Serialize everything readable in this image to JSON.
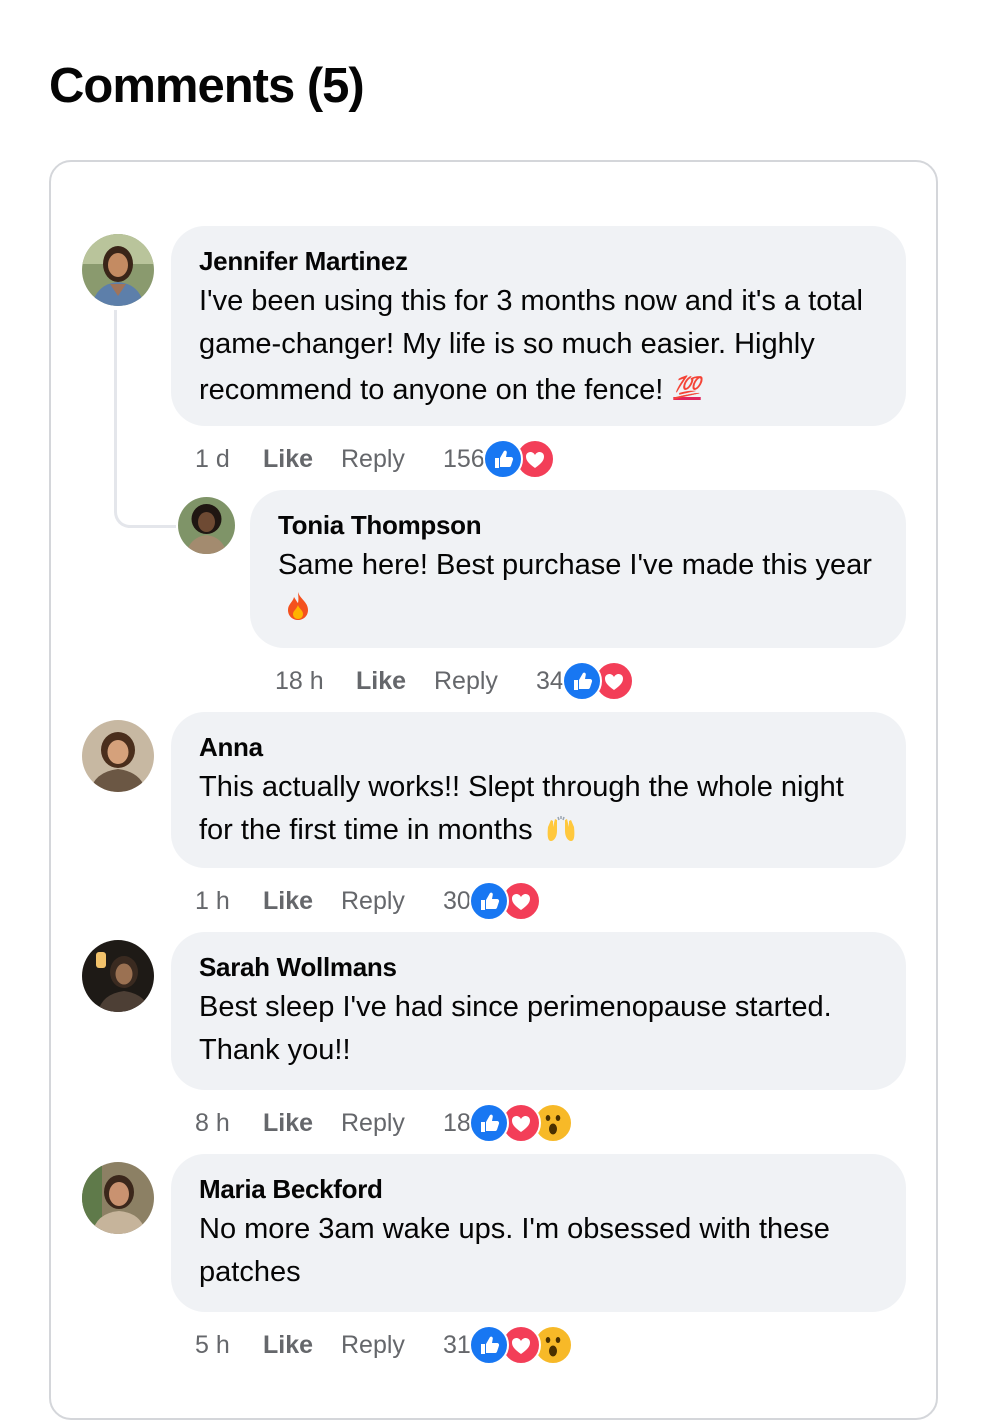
{
  "heading": "Comments (5)",
  "comments": [
    {
      "name": "Jennifer Martinez",
      "text": "I've been using this for 3 months now and it's a total game-changer! My life is so much easier. Highly recommend to anyone on the fence!",
      "emoji": "💯",
      "time": "1 d",
      "like": "Like",
      "reply": "Reply",
      "count": "156",
      "reactions": [
        "like",
        "love"
      ]
    },
    {
      "name": "Tonia Thompson",
      "text": "Same here! Best purchase I've made this year",
      "emoji": "🔥",
      "time": "18 h",
      "like": "Like",
      "reply": "Reply",
      "count": "34",
      "reactions": [
        "like",
        "love"
      ]
    },
    {
      "name": "Anna",
      "text": "This actually works!! Slept through the whole night for the first time in months",
      "emoji": "🙌",
      "time": "1 h",
      "like": "Like",
      "reply": "Reply",
      "count": "30",
      "reactions": [
        "like",
        "love"
      ]
    },
    {
      "name": "Sarah Wollmans",
      "text": "Best sleep I've had since perimenopause started. Thank you!!",
      "time": "8 h",
      "like": "Like",
      "reply": "Reply",
      "count": "18",
      "reactions": [
        "like",
        "love",
        "wow"
      ]
    },
    {
      "name": "Maria Beckford",
      "text": "No more 3am wake ups. I'm obsessed with these patches",
      "time": "5 h",
      "like": "Like",
      "reply": "Reply",
      "count": "31",
      "reactions": [
        "like",
        "love",
        "wow"
      ]
    }
  ],
  "colors": {
    "bubble": "#f0f2f5",
    "like": "#1877f2",
    "love": "#f33e58",
    "wow": "#f7b928",
    "meta": "#65676b"
  }
}
